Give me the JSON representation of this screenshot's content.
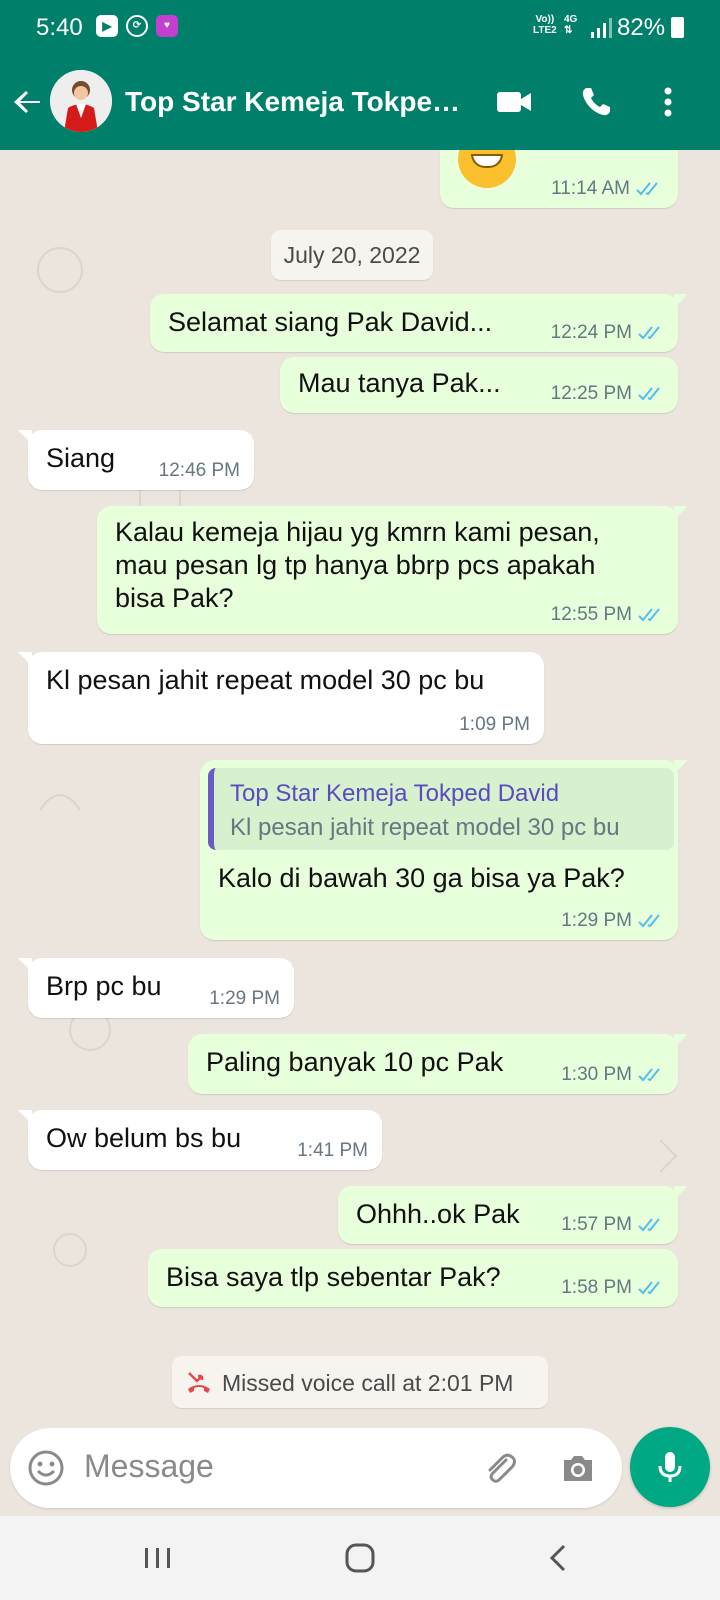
{
  "status_bar": {
    "time": "5:40",
    "network_top": "Vo))",
    "network_bottom": "LTE2",
    "network_type": "4G",
    "battery": "82%",
    "icons": [
      "youtube-icon",
      "sync-icon",
      "lazada-icon"
    ]
  },
  "header": {
    "contact_name": "Top Star Kemeja Tokpe…",
    "icons": [
      "back-arrow-icon",
      "video-call-icon",
      "phone-icon",
      "more-vert-icon"
    ]
  },
  "chat": {
    "top_bubble_time": "11:14 AM",
    "date_chip": "July 20, 2022",
    "messages": [
      {
        "dir": "out",
        "text": "Selamat siang Pak David...",
        "time": "12:24 PM"
      },
      {
        "dir": "out",
        "text": "Mau tanya Pak...",
        "time": "12:25 PM"
      },
      {
        "dir": "in",
        "text": "Siang",
        "time": "12:46 PM"
      },
      {
        "dir": "out",
        "text_lines": [
          "Kalau kemeja hijau yg kmrn kami pesan,",
          "mau pesan lg tp  hanya bbrp pcs apakah",
          "bisa Pak?"
        ],
        "time": "12:55 PM"
      },
      {
        "dir": "in",
        "text": "Kl pesan jahit repeat model 30 pc bu",
        "time": "1:09 PM"
      },
      {
        "dir": "out",
        "quoted_name": "Top Star Kemeja Tokped David",
        "quoted_text": "Kl pesan jahit repeat model 30 pc bu",
        "text": "Kalo di bawah 30 ga bisa ya Pak?",
        "time": "1:29 PM"
      },
      {
        "dir": "in",
        "text": "Brp pc bu",
        "time": "1:29 PM"
      },
      {
        "dir": "out",
        "text": "Paling banyak 10 pc Pak",
        "time": "1:30 PM"
      },
      {
        "dir": "in",
        "text": "Ow belum bs bu",
        "time": "1:41 PM"
      },
      {
        "dir": "out",
        "text": "Ohhh..ok Pak",
        "time": "1:57 PM"
      },
      {
        "dir": "out",
        "text": "Bisa saya tlp sebentar Pak?",
        "time": "1:58 PM"
      }
    ],
    "missed_call": "Missed voice call at 2:01 PM"
  },
  "composer": {
    "placeholder": "Message"
  },
  "colors": {
    "header": "#00806a",
    "outgoing_bubble": "#e7ffdb",
    "incoming_bubble": "#ffffff",
    "read_ticks": "#53bdeb",
    "mic_button": "#00a884",
    "missed_call": "#e5484d"
  }
}
